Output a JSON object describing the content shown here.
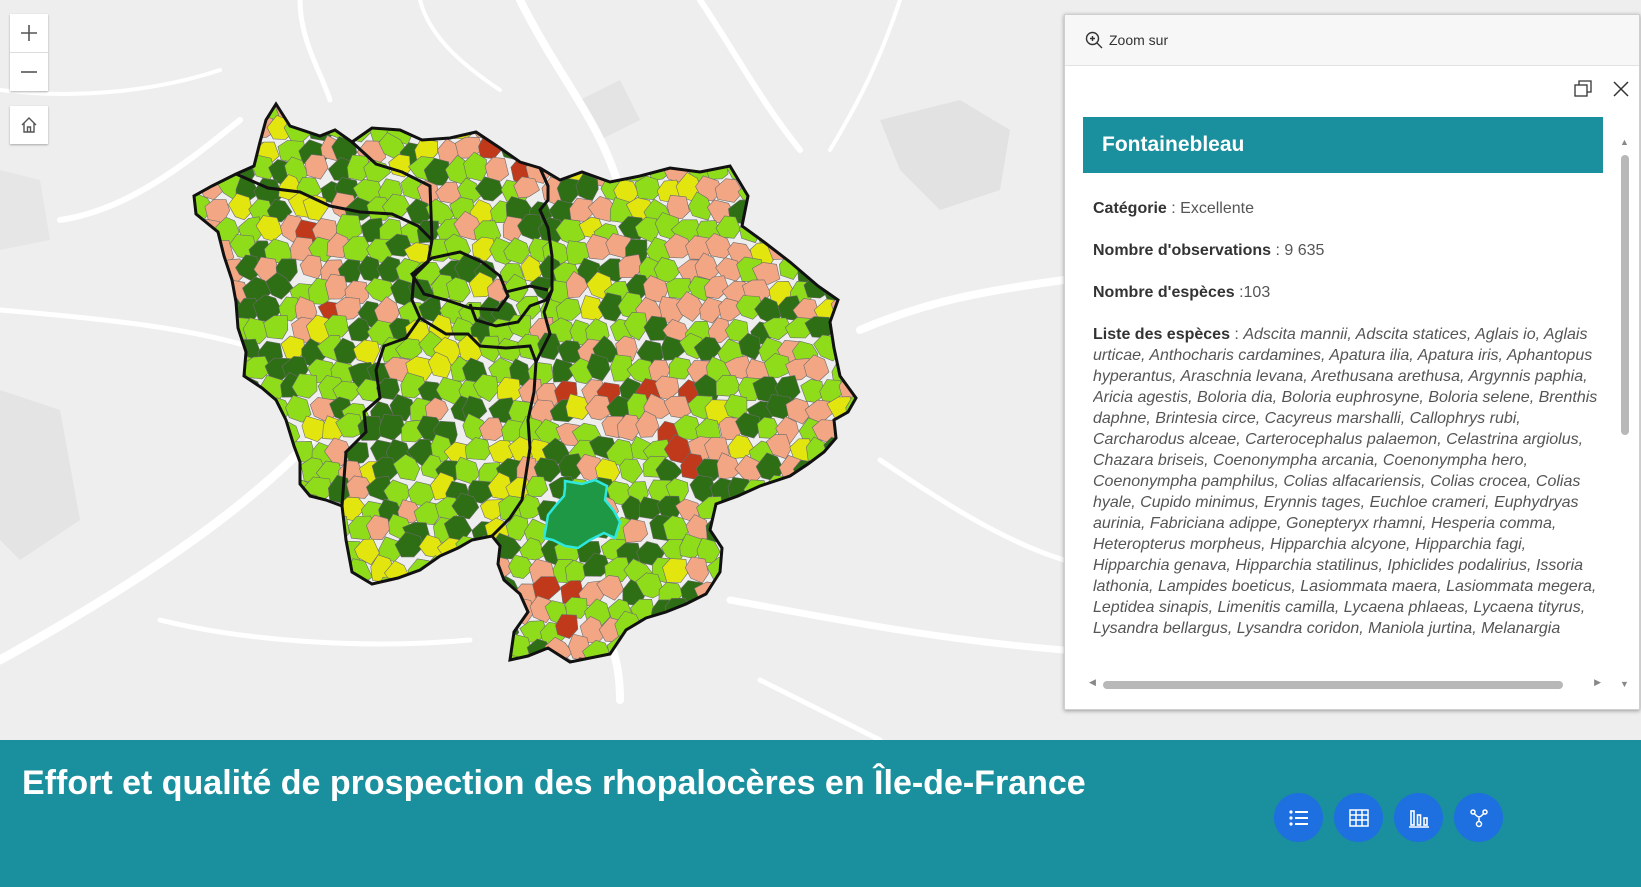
{
  "map": {
    "zoom_in_icon": "plus-icon",
    "zoom_out_icon": "minus-icon",
    "home_icon": "home-icon",
    "colors": {
      "excellent": "#2e6e14",
      "good": "#8fdd1a",
      "medium": "#e3e50f",
      "low": "#f3a684",
      "insufficient": "#c0391a",
      "selected": "#1e9845",
      "selected_outline": "#2ee8e0"
    }
  },
  "popup": {
    "zoom_label": "Zoom sur",
    "title": "Fontainebleau",
    "fields": {
      "category_label": "Catégorie",
      "category_sep": " : ",
      "category_value": "Excellente",
      "observations_label": "Nombre d'observations",
      "observations_sep": " : ",
      "observations_value": "9 635",
      "species_count_label": "Nombre d'espèces",
      "species_count_sep": " :",
      "species_count_value": "103",
      "species_list_label": "Liste des espèces",
      "species_list_sep": " : ",
      "species_list_value": "Adscita mannii, Adscita statices, Aglais io, Aglais urticae, Anthocharis cardamines, Apatura ilia, Apatura iris, Aphantopus hyperantus, Araschnia levana, Arethusana arethusa, Argynnis paphia, Aricia agestis, Boloria dia, Boloria euphrosyne, Boloria selene, Brenthis daphne, Brintesia circe, Cacyreus marshalli, Callophrys rubi, Carcharodus alceae, Carterocephalus palaemon, Celastrina argiolus, Chazara briseis, Coenonympha arcania, Coenonympha hero, Coenonympha pamphilus, Colias alfacariensis, Colias crocea, Colias hyale, Cupido minimus, Erynnis tages, Euchloe crameri, Euphydryas aurinia, Fabriciana adippe, Gonepteryx rhamni, Hesperia comma, Heteropterus morpheus, Hipparchia alcyone, Hipparchia fagi, Hipparchia genava, Hipparchia statilinus, Iphiclides podalirius, Issoria lathonia, Lampides boeticus, Lasiommata maera, Lasiommata megera, Leptidea sinapis, Limenitis camilla, Lycaena phlaeas, Lycaena tityrus, Lysandra bellargus, Lysandra coridon, Maniola jurtina, Melanargia"
    }
  },
  "footer": {
    "title": "Effort et qualité de prospection des rhopalocères en Île-de-France",
    "buttons": [
      "list-icon",
      "table-icon",
      "bar-chart-icon",
      "share-icon"
    ]
  }
}
